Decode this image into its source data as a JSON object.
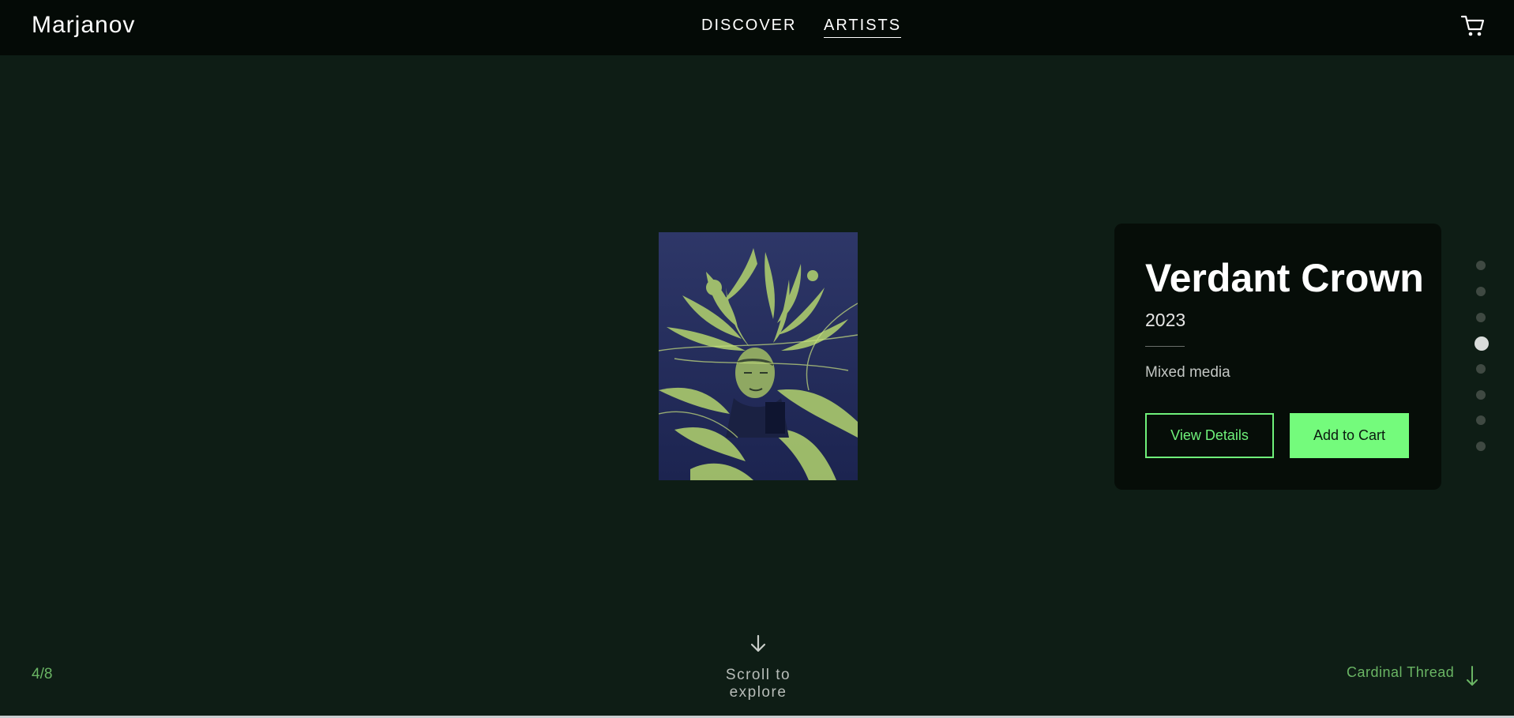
{
  "header": {
    "brand": "Marjanov",
    "nav": [
      {
        "label": "DISCOVER",
        "active": false
      },
      {
        "label": "ARTISTS",
        "active": true
      }
    ],
    "cart_icon": "shopping-cart-icon"
  },
  "artwork": {
    "title": "Verdant Crown",
    "year": "2023",
    "medium": "Mixed media",
    "image_description_icon": "artwork-image"
  },
  "actions": {
    "view_details": "View Details",
    "add_to_cart": "Add to Cart"
  },
  "pagination": {
    "counter": "4/8",
    "total_slides": 8,
    "active_slide": 4
  },
  "scroll": {
    "label": "Scroll to explore",
    "icon": "arrow-down-icon"
  },
  "next": {
    "label": "Cardinal Thread",
    "icon": "arrow-down-icon"
  },
  "colors": {
    "background": "#0e1d15",
    "header": "#040a06",
    "card": "#060d08",
    "accent": "#74fb7c",
    "accent_text": "#6ab564"
  }
}
